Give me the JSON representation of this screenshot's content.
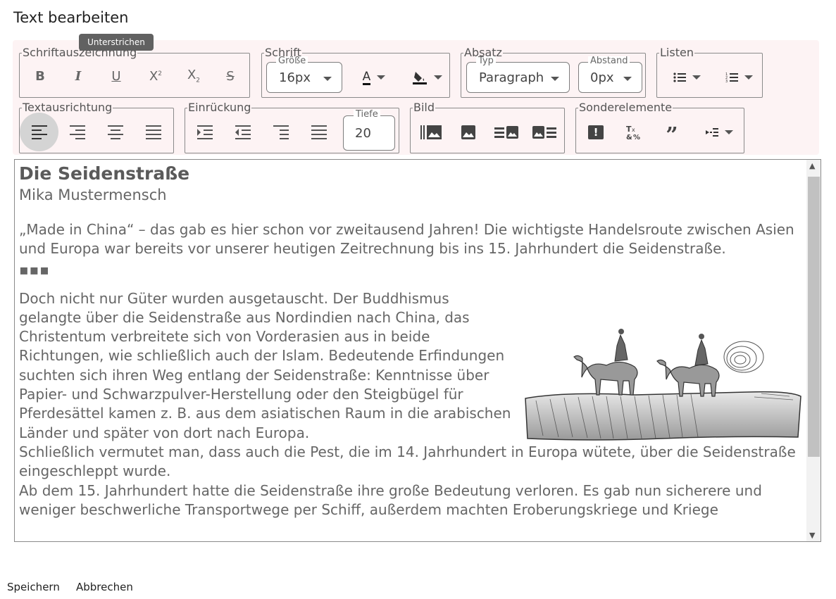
{
  "title": "Text bearbeiten",
  "tooltip": "Unterstrichen",
  "groups": {
    "schriftauszeichnung": "Schriftauszeichnung",
    "schrift": "Schrift",
    "absatz": "Absatz",
    "listen": "Listen",
    "textausrichtung": "Textausrichtung",
    "einrueckung": "Einrückung",
    "bild": "Bild",
    "sonderelemente": "Sonderelemente"
  },
  "schrift": {
    "size_label": "Größe",
    "size_value": "16px"
  },
  "absatz": {
    "type_label": "Typ",
    "type_value": "Paragraph",
    "spacing_label": "Abstand",
    "spacing_value": "0px"
  },
  "einrueckung": {
    "depth_label": "Tiefe",
    "depth_value": "20"
  },
  "icons": {
    "bold": "B",
    "italic": "I",
    "underline": "U",
    "superscript": "X",
    "subscript": "X",
    "strikethrough": "S",
    "font-color": "A",
    "highlight": "paint-bucket-icon",
    "bullet-list": "bullet-list-icon",
    "numbered-list": "numbered-list-icon",
    "warning": "!",
    "quote": "”"
  },
  "content": {
    "heading": "Die Seidenstraße",
    "author": "Mika Mustermensch",
    "intro": "„Made in China“ – das gab es hier schon vor zweitausend Jahren! Die wichtigste Handelsroute zwischen Asien und Europa war bereits vor unserer heutigen Zeitrechnung bis ins 15. Jahrhundert die Seidenstraße.",
    "ellipsis": "▪▪▪",
    "para1": "Doch nicht nur Güter wurden ausgetauscht. Der Buddhismus gelangte über die Seidenstraße aus Nordindien nach China, das Christentum verbreitete sich von Vorderasien aus in beide Richtungen, wie schließlich auch der Islam. Bedeutende Erfindungen suchten sich ihren Weg entlang der Seidenstraße: Kenntnisse über Papier- und Schwarzpulver-Herstellung oder den Steigbügel für Pferdesättel kamen z. B. aus dem asiatischen Raum in die arabischen Länder und später von dort nach Europa.",
    "para2": "Schließlich vermutet man, dass auch die Pest, die im 14. Jahrhundert in Europa wütete, über die Seidenstraße eingeschleppt wurde.",
    "para3": "Ab dem 15. Jahrhundert hatte die Seidenstraße ihre große Bedeutung verloren. Es gab nun sicherere und weniger beschwerliche Transportwege per Schiff, außerdem machten Eroberungskriege und Kriege"
  },
  "footer": {
    "save": "Speichern",
    "cancel": "Abbrechen"
  }
}
